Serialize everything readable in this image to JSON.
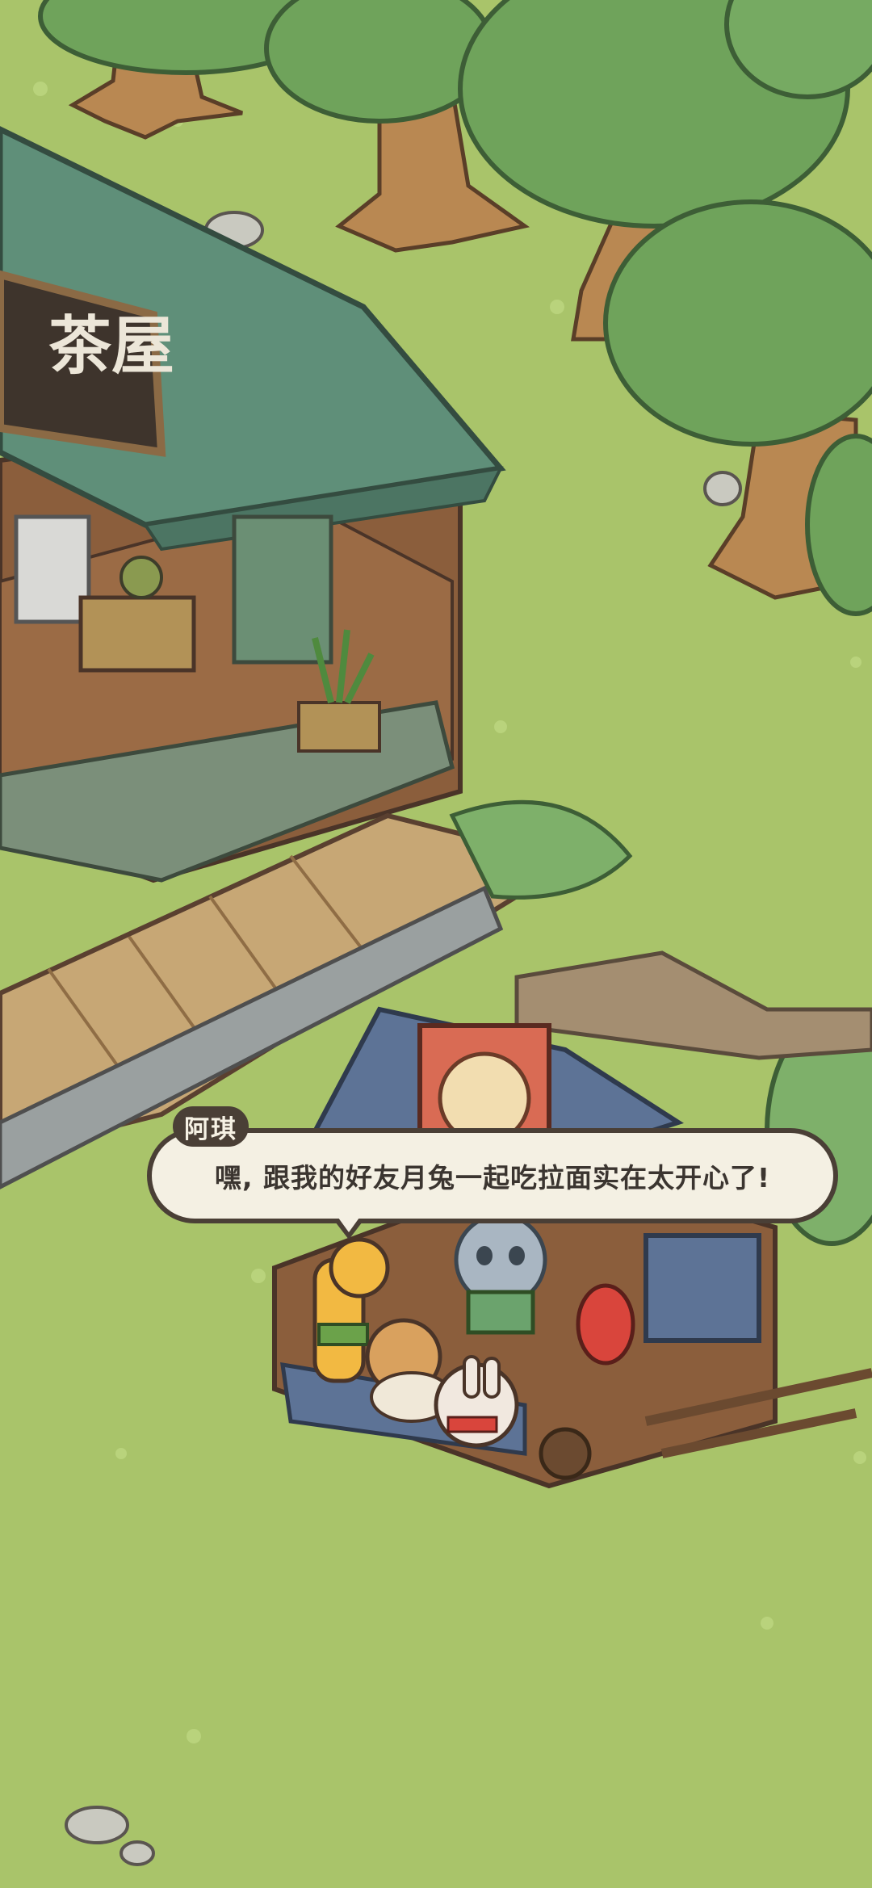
{
  "scene": {
    "ground_color": "#a9c46a",
    "tree_color": "#6fa35b",
    "roof_color": "#5f8f79",
    "wood_color": "#8b5e3c",
    "shop_sign": "茶屋"
  },
  "dialogue": {
    "speaker": "阿琪",
    "text": "嘿, 跟我的好友月兔一起吃拉面实在太开心了!"
  }
}
